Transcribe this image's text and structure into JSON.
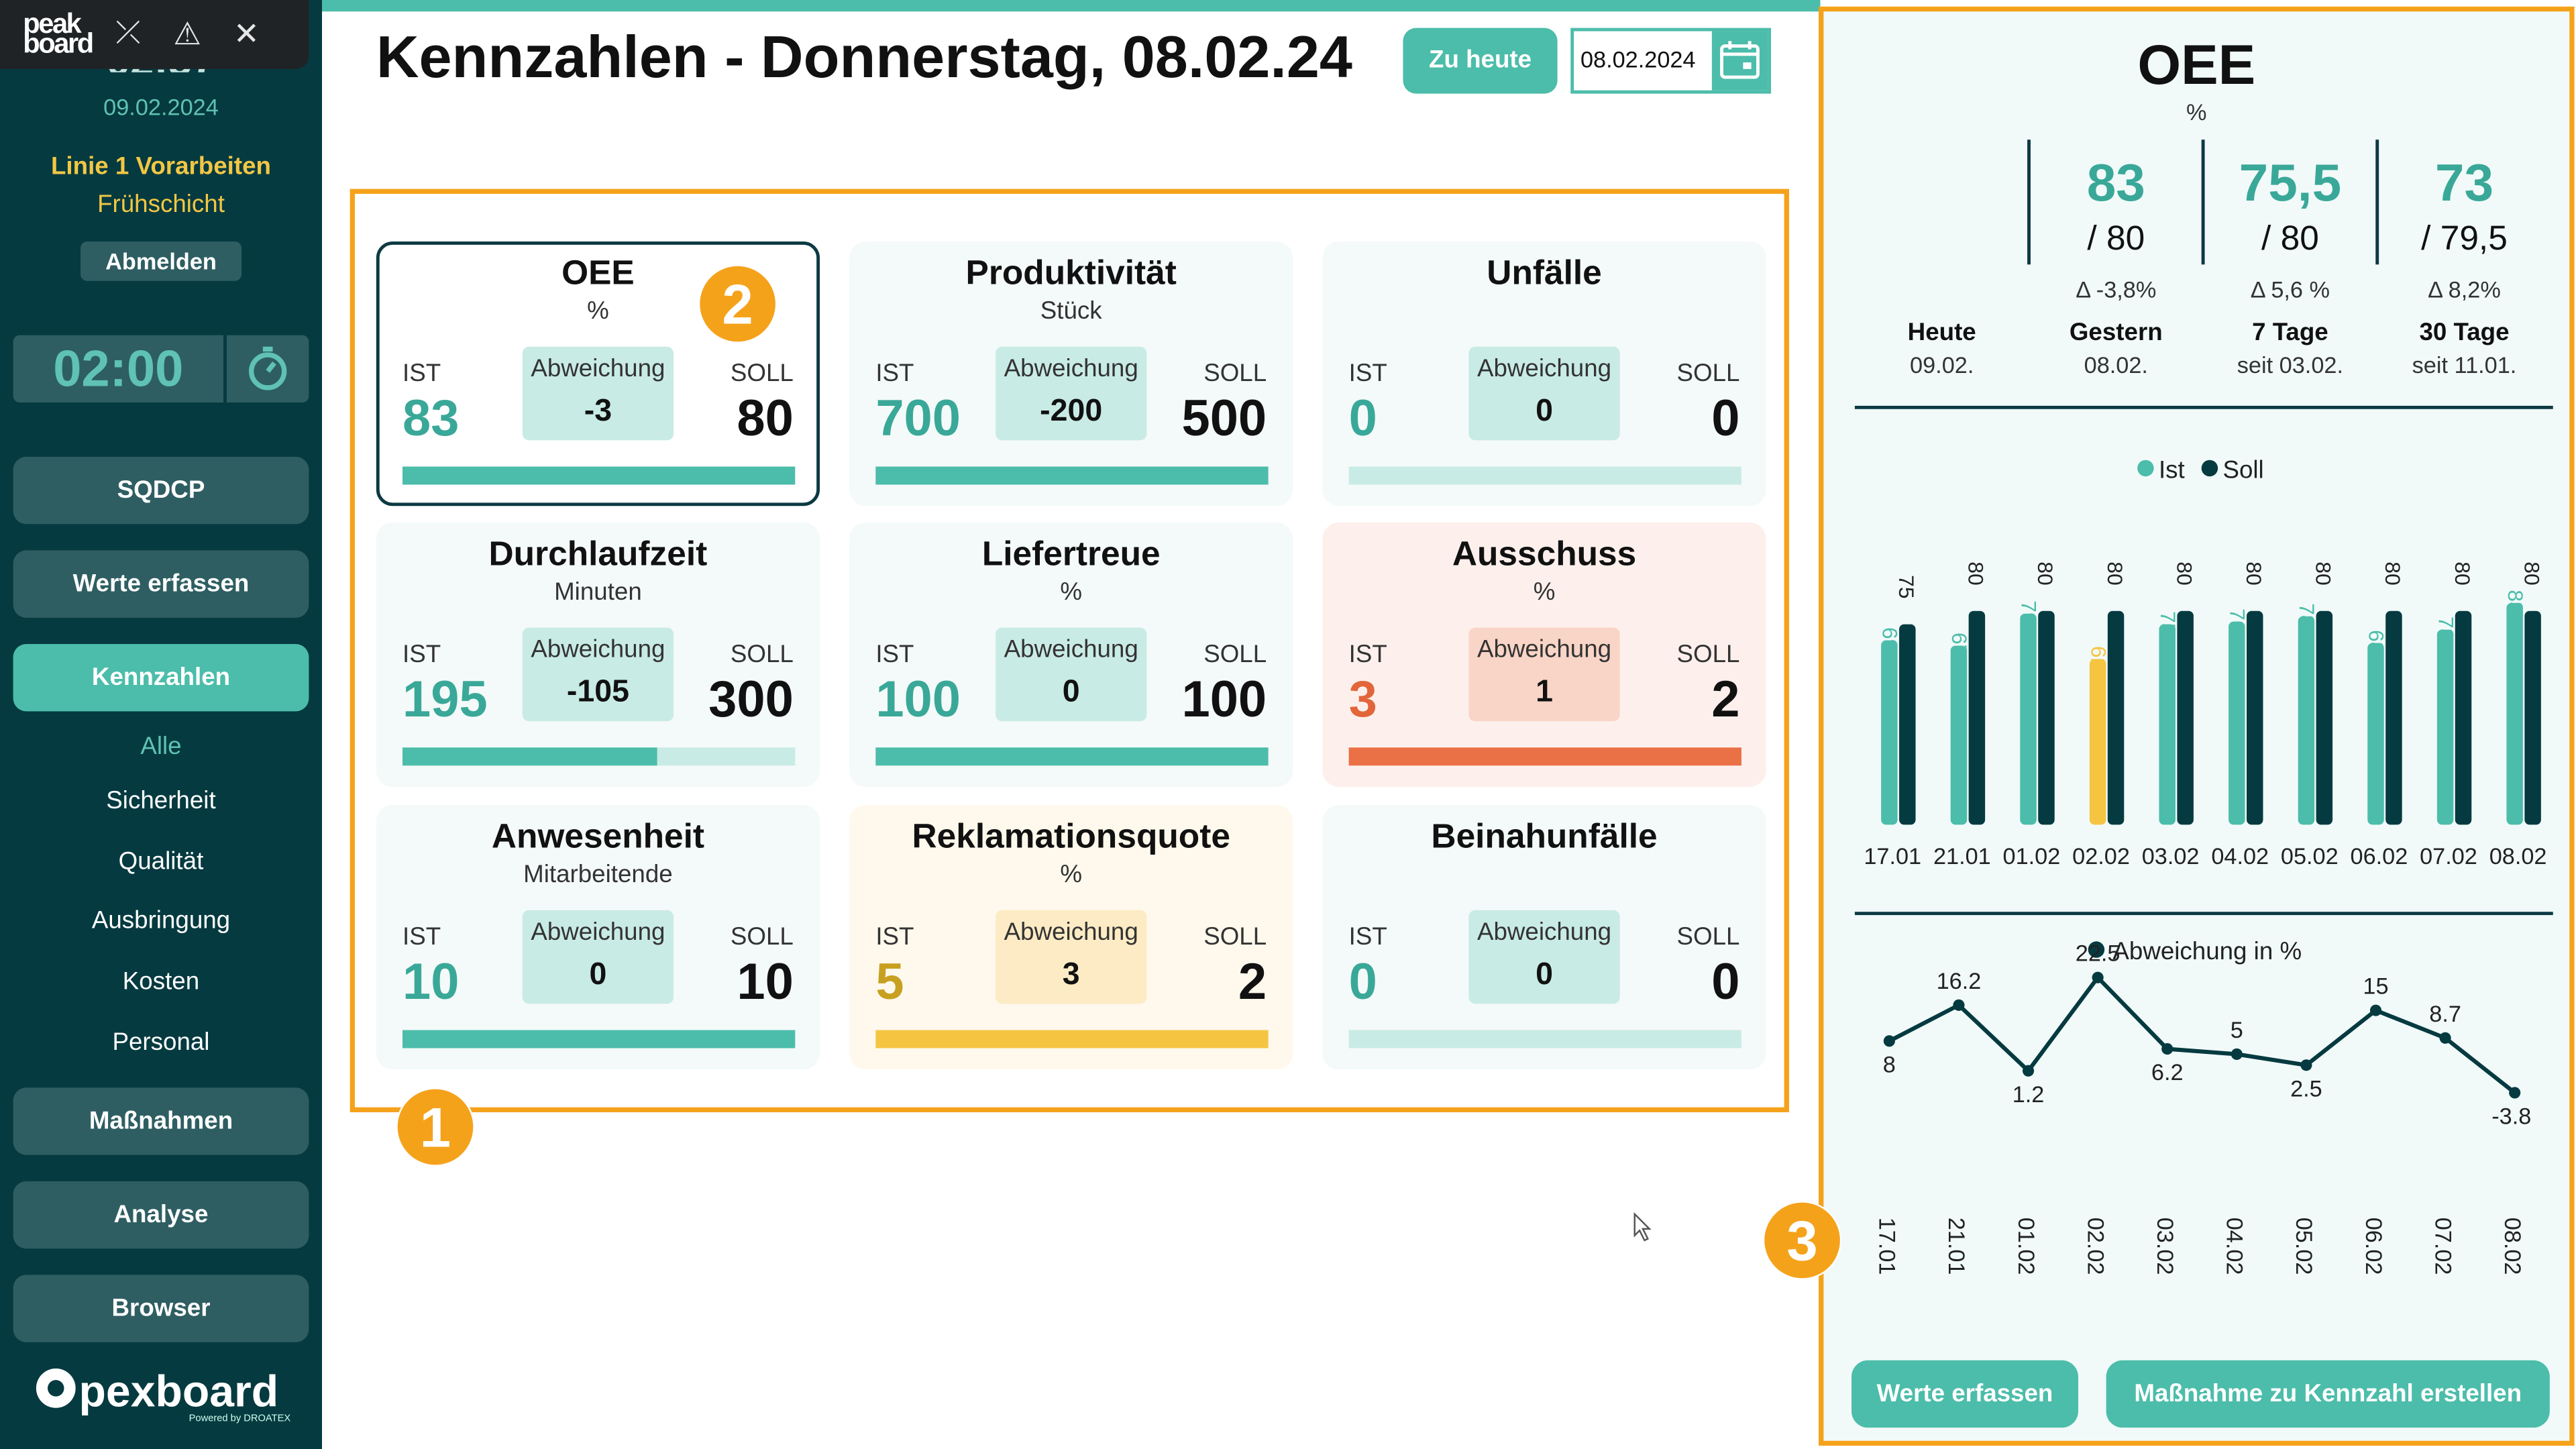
{
  "sidebar": {
    "logo": "peak board",
    "date": "09.02.2024",
    "line": "Linie 1 Vorarbeiten",
    "shift": "Frühschicht",
    "logout": "Abmelden",
    "timer": "02:00",
    "nav": {
      "sqdcp": "SQDCP",
      "werte": "Werte erfassen",
      "kennzahlen": "Kennzahlen",
      "massnahmen": "Maßnahmen",
      "analyse": "Analyse",
      "browser": "Browser"
    },
    "subnav": [
      "Alle",
      "Sicherheit",
      "Qualität",
      "Ausbringung",
      "Kosten",
      "Personal"
    ],
    "brand": "pexboard",
    "brand_sub": "Powered by DROATEX"
  },
  "header": {
    "title": "Kennzahlen - Donnerstag, 08.02.24",
    "today_button": "Zu heute",
    "date_value": "08.02.2024"
  },
  "labels": {
    "ist": "IST",
    "soll": "SOLL",
    "abweichung": "Abweichung"
  },
  "kpis": [
    {
      "title": "OEE",
      "unit": "%",
      "ist": "83",
      "abweichung": "-3",
      "soll": "80",
      "progress": 1.0
    },
    {
      "title": "Produktivität",
      "unit": "Stück",
      "ist": "700",
      "abweichung": "-200",
      "soll": "500",
      "progress": 1.0
    },
    {
      "title": "Unfälle",
      "unit": "",
      "ist": "0",
      "abweichung": "0",
      "soll": "0",
      "progress": 0
    },
    {
      "title": "Durchlaufzeit",
      "unit": "Minuten",
      "ist": "195",
      "abweichung": "-105",
      "soll": "300",
      "progress": 0.65
    },
    {
      "title": "Liefertreue",
      "unit": "%",
      "ist": "100",
      "abweichung": "0",
      "soll": "100",
      "progress": 1.0
    },
    {
      "title": "Ausschuss",
      "unit": "%",
      "ist": "3",
      "abweichung": "1",
      "soll": "2",
      "progress": 1.0
    },
    {
      "title": "Anwesenheit",
      "unit": "Mitarbeitende",
      "ist": "10",
      "abweichung": "0",
      "soll": "10",
      "progress": 1.0
    },
    {
      "title": "Reklamationsquote",
      "unit": "%",
      "ist": "5",
      "abweichung": "3",
      "soll": "2",
      "progress": 1.0
    },
    {
      "title": "Beinahunfälle",
      "unit": "",
      "ist": "0",
      "abweichung": "0",
      "soll": "0",
      "progress": 0
    }
  ],
  "badges": {
    "one": "1",
    "two": "2",
    "three": "3"
  },
  "colors": {
    "teal": "#4cbdaa",
    "teal_light": "#c9ebe5",
    "dark": "#053a40",
    "red": "#ea7045",
    "red_light": "#f9d5c7",
    "yellow": "#f5c542",
    "yellow_light": "#fcebc4",
    "orange_frame": "#f5a21b"
  },
  "panel": {
    "title": "OEE",
    "unit": "%",
    "stats": [
      {
        "big": "",
        "soll": "",
        "delta": "",
        "label": "Heute",
        "sub": "09.02."
      },
      {
        "big": "83",
        "soll": "/ 80",
        "delta": "Δ -3,8%",
        "label": "Gestern",
        "sub": "08.02."
      },
      {
        "big": "75,5",
        "soll": "/ 80",
        "delta": "Δ 5,6 %",
        "label": "7 Tage",
        "sub": "seit 03.02."
      },
      {
        "big": "73",
        "soll": "/ 79,5",
        "delta": "Δ 8,2%",
        "label": "30 Tage",
        "sub": "seit 11.01."
      }
    ],
    "buttons": {
      "werte": "Werte erfassen",
      "massnahme": "Maßnahme zu Kennzahl erstellen"
    }
  },
  "chart_data": [
    {
      "type": "bar",
      "legend": [
        "Ist",
        "Soll"
      ],
      "legend_placement": "top-center",
      "categories": [
        "17.01",
        "21.01",
        "01.02",
        "02.02",
        "03.02",
        "04.02",
        "05.02",
        "06.02",
        "07.02",
        "08.02"
      ],
      "series": [
        {
          "name": "Ist",
          "values": [
            69,
            67,
            79,
            62,
            75,
            76,
            78,
            68,
            73,
            83
          ],
          "colors": [
            "#4cbdaa",
            "#4cbdaa",
            "#4cbdaa",
            "#f5c542",
            "#4cbdaa",
            "#4cbdaa",
            "#4cbdaa",
            "#4cbdaa",
            "#4cbdaa",
            "#4cbdaa"
          ]
        },
        {
          "name": "Soll",
          "values": [
            75,
            80,
            80,
            80,
            80,
            80,
            80,
            80,
            80,
            80
          ],
          "color": "#053a40"
        }
      ],
      "ylim": [
        0,
        85
      ]
    },
    {
      "type": "line",
      "legend": [
        "Abweichung in %"
      ],
      "x": [
        "17.01",
        "21.01",
        "01.02",
        "02.02",
        "03.02",
        "04.02",
        "05.02",
        "06.02",
        "07.02",
        "08.02"
      ],
      "series": [
        {
          "name": "Abweichung in %",
          "values": [
            8,
            16.2,
            1.2,
            22.5,
            6.2,
            5,
            2.5,
            15,
            8.7,
            -3.8
          ],
          "labels": [
            "8",
            "16.2",
            "1.2",
            "22.5",
            "6.2",
            "5",
            "2.5",
            "15",
            "8.7",
            "-3.8"
          ]
        }
      ]
    }
  ]
}
